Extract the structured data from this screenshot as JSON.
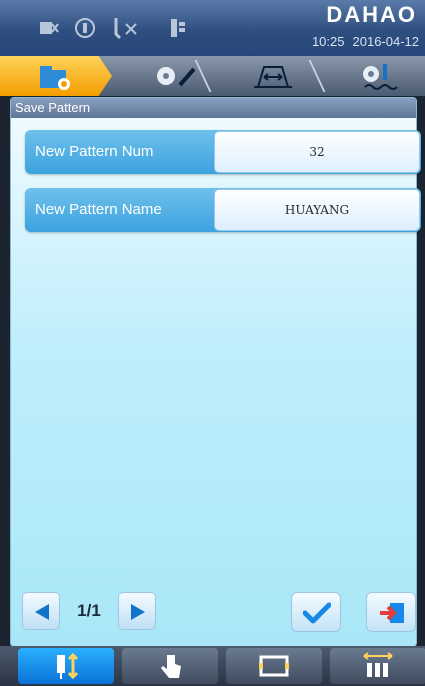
{
  "header": {
    "brand": "DAHAO",
    "time": "10:25",
    "date": "2016-04-12",
    "status_icons": [
      "machine-status-icon",
      "thread-status-icon",
      "needle-cut-icon",
      "frame-mode-icon"
    ]
  },
  "steps": [
    "open-pattern-icon",
    "edit-pattern-icon",
    "frame-offset-icon",
    "embroidery-icon"
  ],
  "dialog": {
    "title": "Save Pattern",
    "rows": [
      {
        "label": "New Pattern Num",
        "value": "32"
      },
      {
        "label": "New Pattern Name",
        "value": "HUAYANG"
      }
    ]
  },
  "pager": {
    "text": "1/1"
  },
  "actions": {
    "confirm": "checkmark-icon",
    "exit": "exit-icon"
  },
  "bottom_tabs": [
    "needle-mode-icon",
    "manual-hand-icon",
    "frame-icon",
    "needle-rack-icon"
  ],
  "colors": {
    "accent": "#f6a800",
    "row": "#3ca3de",
    "active_tab": "#1b8ff0"
  }
}
